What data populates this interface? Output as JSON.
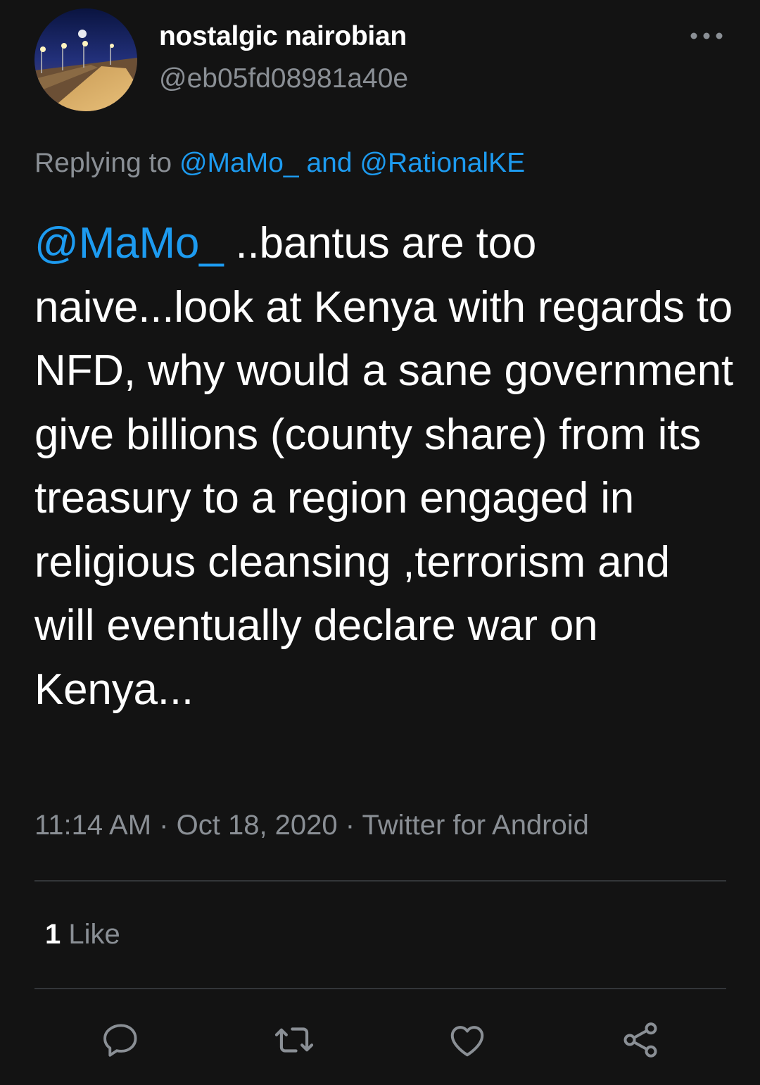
{
  "tweet": {
    "author": {
      "display_name": "nostalgic nairobian",
      "handle": "@eb05fd08981a40e",
      "avatar_icon": "avatar-night-road-photo"
    },
    "more_icon": "more-dots-icon",
    "replying": {
      "prefix": "Replying to",
      "mention_1": "@MaMo_",
      "conjunction": "and",
      "mention_2": "@RationalKE"
    },
    "body": {
      "mention": "@MaMo_",
      "text": " ..bantus are too naive...look at Kenya with regards to NFD, why would a sane government give billions (county share) from its treasury to a region engaged in religious cleansing ,terrorism and will eventually declare war on Kenya..."
    },
    "meta": {
      "time": "11:14 AM",
      "separator": "·",
      "date": "Oct 18, 2020",
      "source": "Twitter for Android"
    },
    "stats": {
      "like_count": "1",
      "like_label": "Like"
    },
    "actions": [
      {
        "icon": "reply-icon"
      },
      {
        "icon": "retweet-icon"
      },
      {
        "icon": "like-heart-icon"
      },
      {
        "icon": "share-icon"
      }
    ]
  },
  "colors": {
    "background": "#131313",
    "text_primary": "#ffffff",
    "text_secondary": "#8a8f95",
    "link": "#1d9bf0",
    "divider": "#333639"
  }
}
